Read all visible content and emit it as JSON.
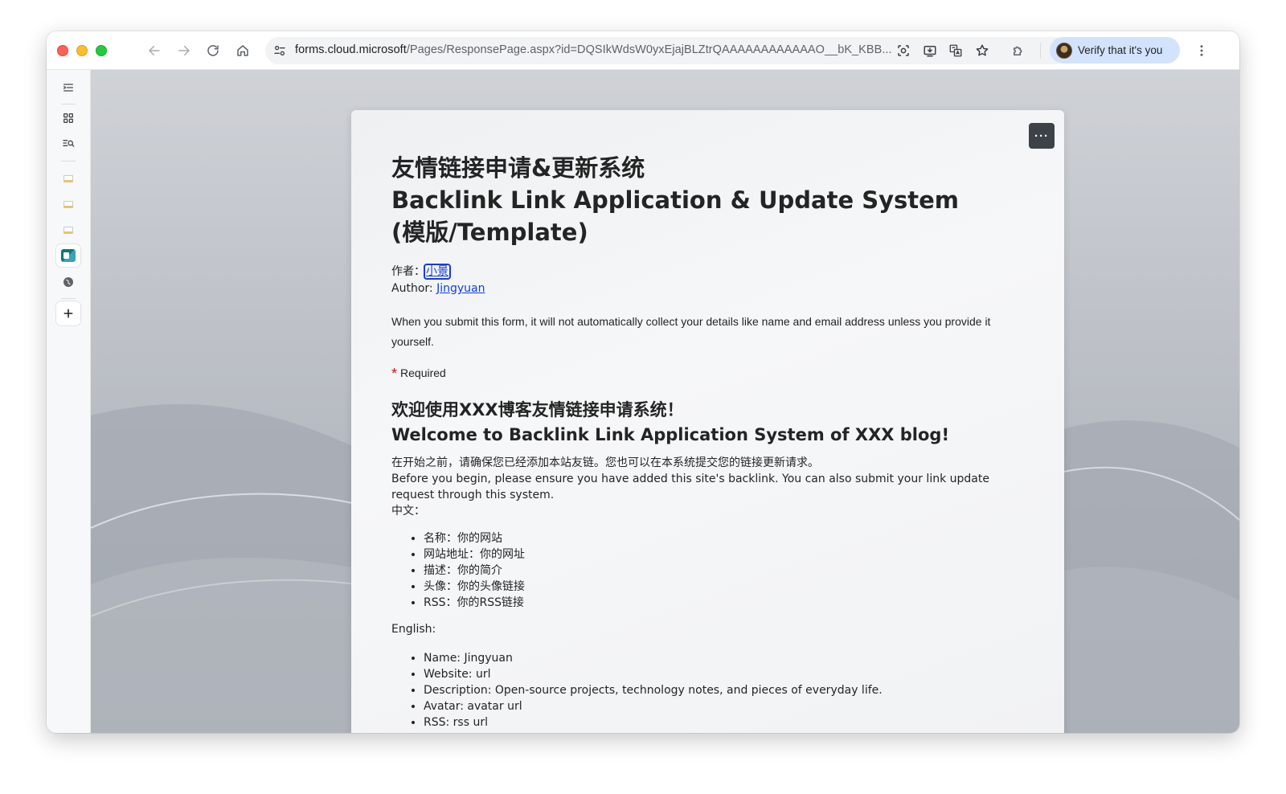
{
  "browser": {
    "url_host": "forms.cloud.microsoft",
    "url_path": "/Pages/ResponsePage.aspx?id=DQSIkWdsW0yxEjajBLZtrQAAAAAAAAAAAAO__bK_KBB...",
    "profile_label": "Verify that it's you"
  },
  "form": {
    "title_line1": "友情链接申请&更新系统",
    "title_line2": "Backlink Link Application & Update System",
    "title_line3": "(模版/Template)",
    "author_cn_label": "作者：",
    "author_cn_name": "小景",
    "author_en_label": "Author: ",
    "author_en_name": "Jingyuan",
    "privacy_notice": "When you submit this form, it will not automatically collect your details like name and email address unless you provide it yourself.",
    "required_star": "*",
    "required_label": "Required",
    "welcome_cn": "欢迎使用XXX博客友情链接申请系统！",
    "welcome_en": "Welcome to Backlink Link Application System of XXX blog!",
    "desc_cn": "在开始之前，请确保您已经添加本站友链。您也可以在本系统提交您的链接更新请求。",
    "desc_en": "Before you begin, please ensure you have added this site's backlink. You can also submit your link update request through this system.",
    "cn_label": "中文：",
    "cn_items": [
      "名称：你的网站",
      "网站地址：你的网址",
      "描述：你的简介",
      "头像：你的头像链接",
      "RSS：你的RSS链接"
    ],
    "en_label": "English:",
    "en_items": [
      "Name: Jingyuan",
      "Website: url",
      "Description: Open-source projects, technology notes, and pieces of everyday life.",
      "Avatar: avatar url",
      "RSS: rss url"
    ],
    "more_button": "···"
  }
}
